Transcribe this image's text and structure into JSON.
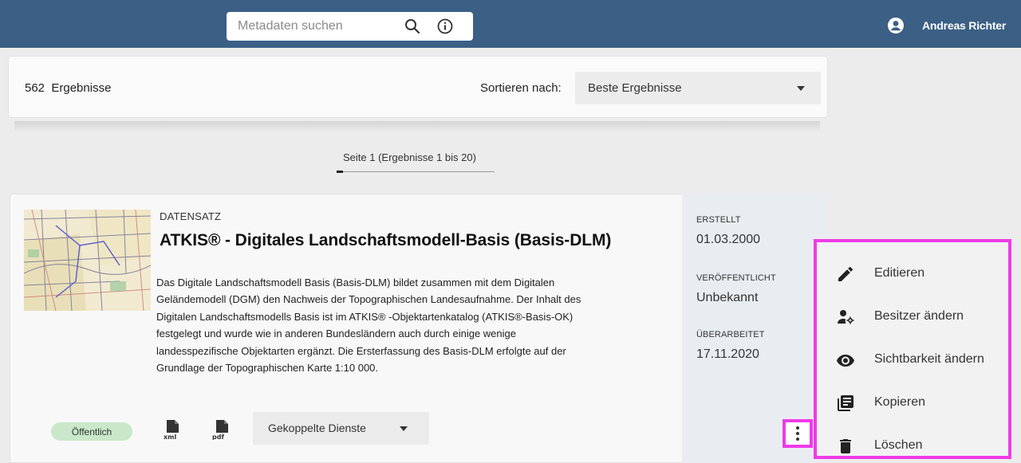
{
  "header": {
    "search": {
      "placeholder": "Metadaten suchen",
      "value": ""
    },
    "icons": [
      "search-icon",
      "info-icon",
      "account-circle-icon"
    ],
    "user_name": "Andreas Richter",
    "bar_color": "#3b5f85"
  },
  "results": {
    "count_label": "562  Ergebnisse",
    "sort_label": "Sortieren nach:",
    "sort_value": "Beste Ergebnisse"
  },
  "pagination": {
    "label": "Seite 1 (Ergebnisse 1 bis 20)"
  },
  "record": {
    "type": "DATENSATZ",
    "title": "ATKIS® - Digitales Landschaftsmodell-Basis (Basis-DLM)",
    "description_lines": [
      "Das Digitale Landschaftsmodell Basis (Basis-DLM) bildet zusammen mit dem Digitalen",
      "Geländemodell (DGM) den Nachweis der Topographischen Landesaufnahme. Der Inhalt des",
      "Digitalen Landschaftsmodells Basis ist im ATKIS® -Objektartenkatalog (ATKIS®-Basis-OK)",
      "festgelegt und wurde wie in anderen Bundesländern auch durch einige wenige",
      "landesspezifische Objektarten ergänzt. Die Ersterfassung des Basis-DLM erfolgte auf der",
      "Grundlage der Topographischen Karte 1:10 000."
    ],
    "badge": "Öffentlich",
    "badge_color": "#c9e8c9",
    "file_icons": [
      "xml-file-icon",
      "pdf-file-icon"
    ],
    "coupled_services": "Gekoppelte Dienste",
    "meta": {
      "created_label": "ERSTELLT",
      "created_value": "01.03.2000",
      "published_label": "VERÖFFENTLICHT",
      "published_value": "Unbekannt",
      "revised_label": "ÜBERARBEITET",
      "revised_value": "17.11.2020"
    }
  },
  "context_menu": {
    "highlight_color": "#ef3be8",
    "items": [
      {
        "label": "Editieren",
        "icon": "pencil-icon"
      },
      {
        "label": "Besitzer ändern",
        "icon": "change-owner-icon"
      },
      {
        "label": "Sichtbarkeit ändern",
        "icon": "eye-icon"
      },
      {
        "label": "Kopieren",
        "icon": "copy-icon"
      },
      {
        "label": "Löschen",
        "icon": "trash-icon"
      }
    ]
  }
}
